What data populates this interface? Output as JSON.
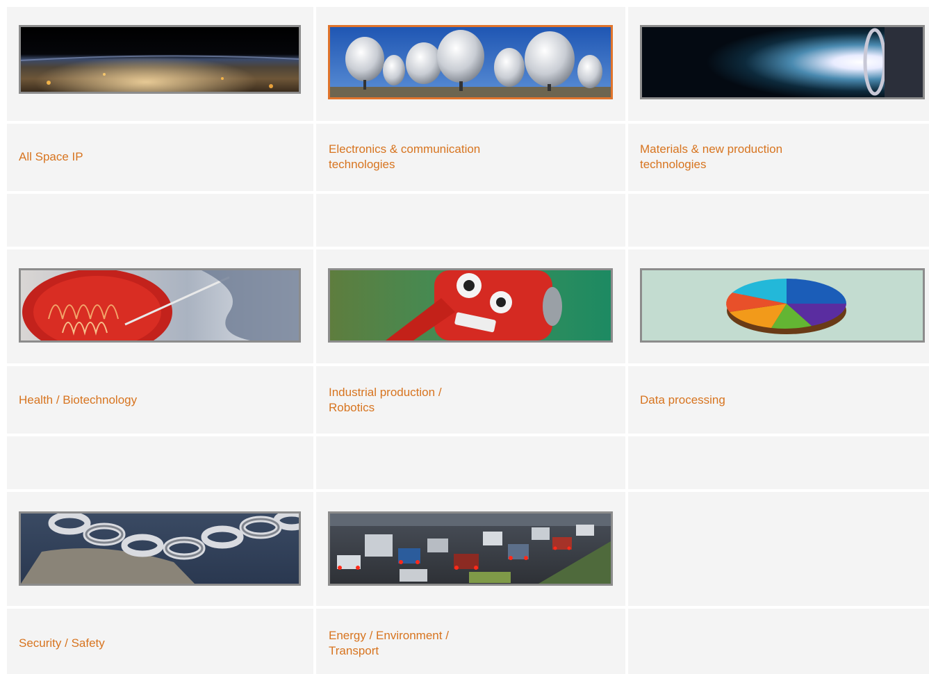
{
  "categories": [
    {
      "label": "All Space IP",
      "image": "earth-horizon-image",
      "active": false
    },
    {
      "label": "Electronics & communication\ntechnologies",
      "image": "radio-telescope-dishes-image",
      "active": true
    },
    {
      "label": "Materials & new production\ntechnologies",
      "image": "plasma-thruster-image",
      "active": false
    },
    {
      "label": "Health / Biotechnology",
      "image": "petri-dish-image",
      "active": false
    },
    {
      "label": "Industrial production /\nRobotics",
      "image": "red-robot-image",
      "active": false
    },
    {
      "label": "Data processing",
      "image": "pie-chart-image",
      "active": false
    },
    {
      "label": "Security / Safety",
      "image": "chain-padlock-image",
      "active": false
    },
    {
      "label": "Energy / Environment /\nTransport",
      "image": "traffic-highway-image",
      "active": false
    }
  ],
  "colors": {
    "link": "#d7741f",
    "cell_background": "#f4f4f4",
    "image_border": "#8c8c8c",
    "active_border": "#e0742c"
  }
}
